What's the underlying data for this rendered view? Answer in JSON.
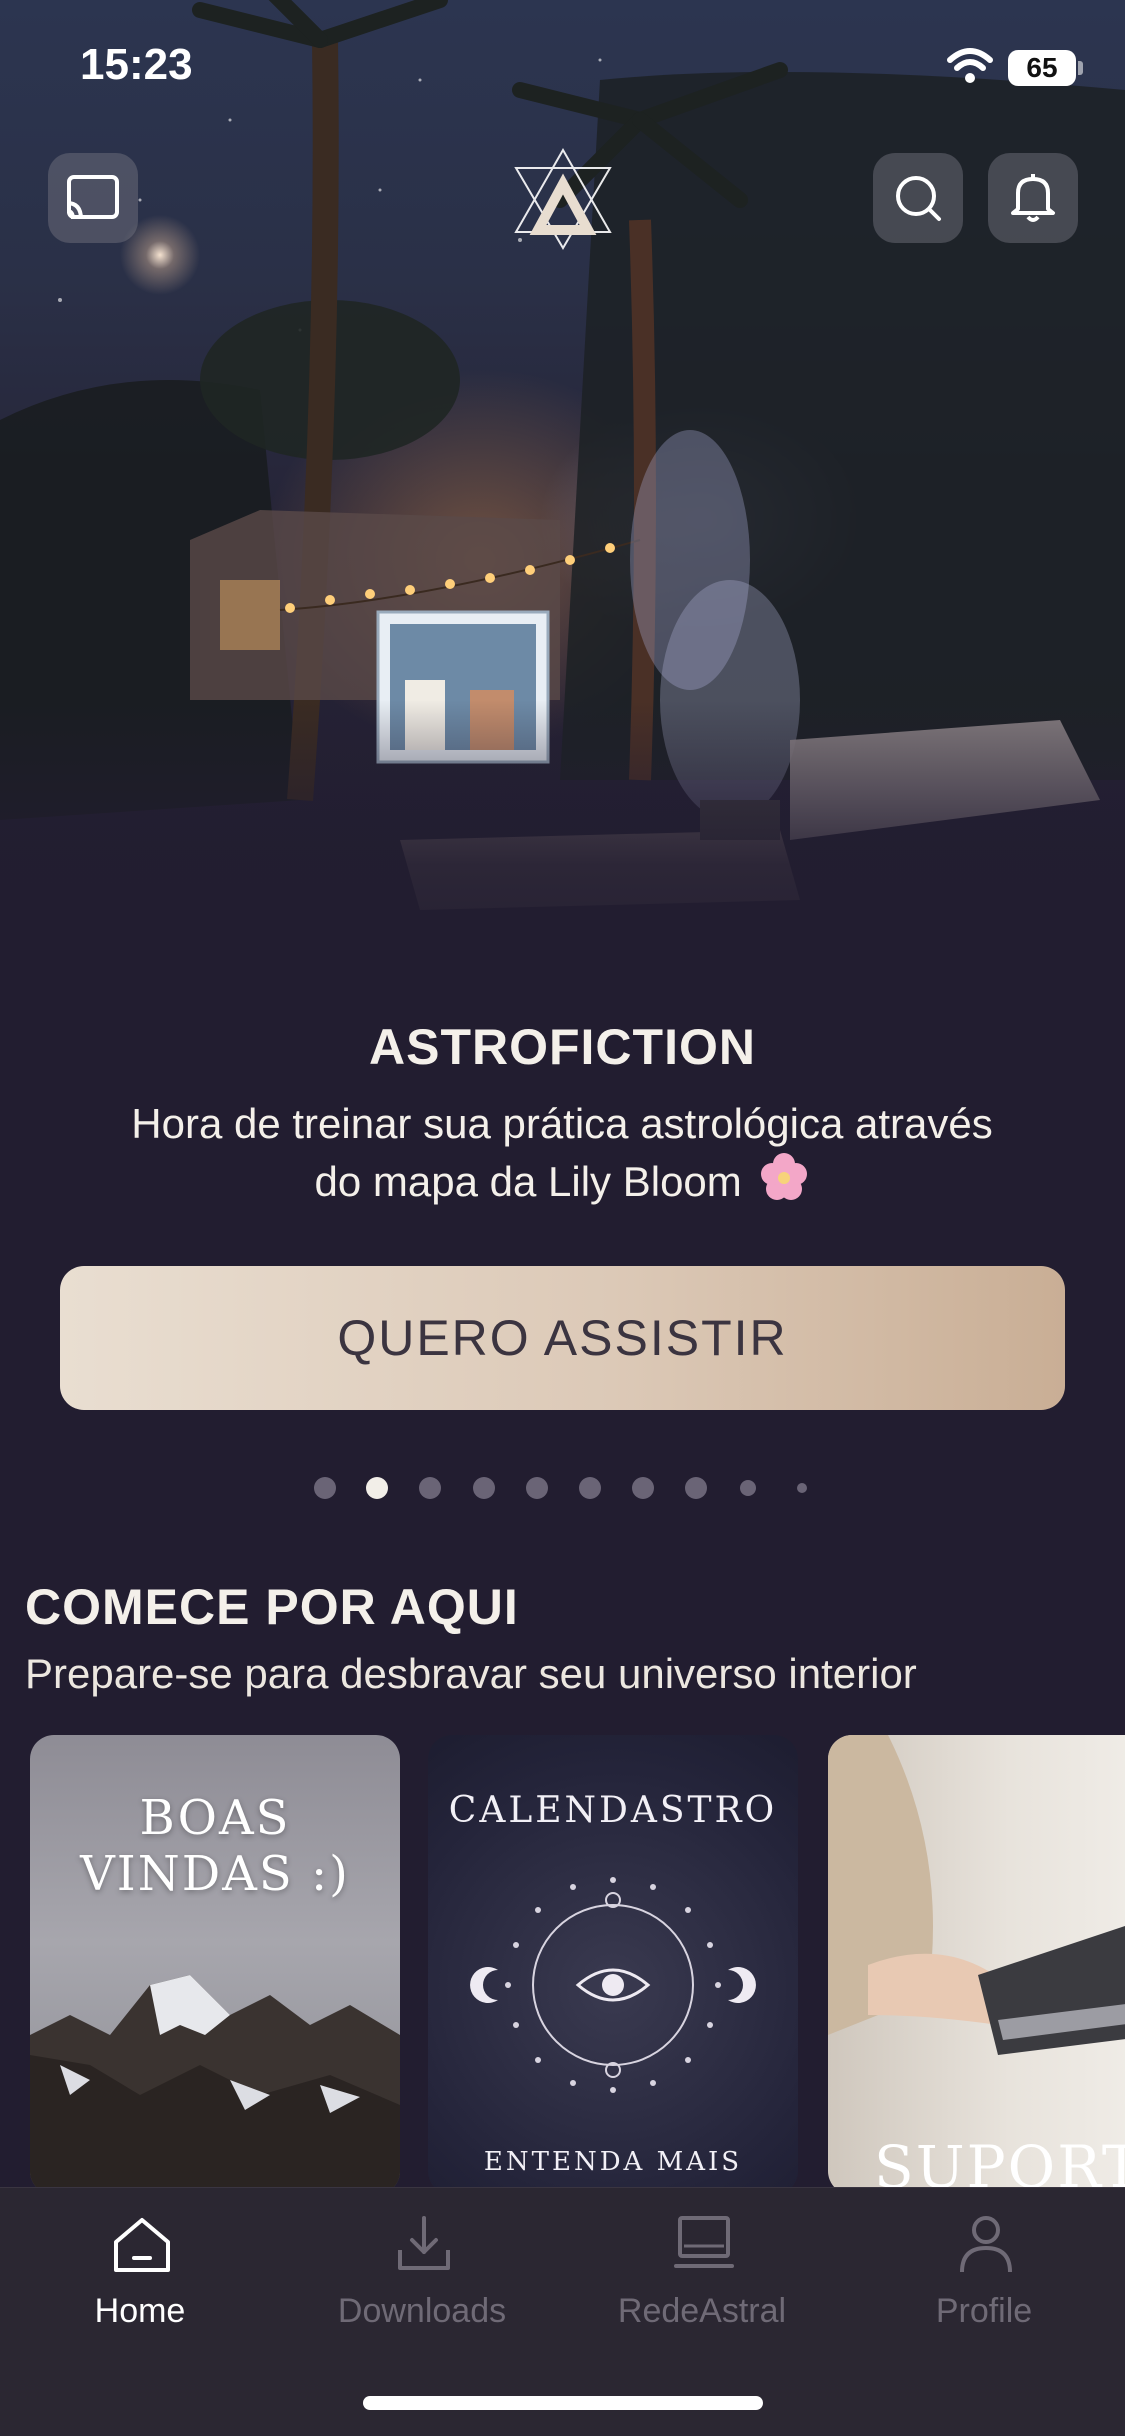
{
  "status_bar": {
    "time": "15:23",
    "battery": "65",
    "icons": [
      "wifi-icon",
      "battery-icon"
    ]
  },
  "header": {
    "left_icon": "cast-icon",
    "logo_icon": "astral-triangle-logo-icon",
    "right_icons": [
      "search-icon",
      "bell-icon"
    ]
  },
  "hero": {
    "title": "ASTROFICTION",
    "subtitle": "Hora de treinar sua prática astrológica através do mapa da Lily Bloom",
    "subtitle_emoji_icon": "cherry-blossom-icon",
    "cta_label": "QUERO ASSISTIR",
    "pagination": {
      "count": 10,
      "active_index": 1
    }
  },
  "section": {
    "title": "COMECE POR AQUI",
    "subtitle": "Prepare-se para desbravar seu universo interior",
    "cards": [
      {
        "title": "BOAS VINDAS :)"
      },
      {
        "title": "CALENDASTRO",
        "subtitle": "ENTENDA MAIS"
      },
      {
        "title": "SUPORTE"
      }
    ]
  },
  "tab_bar": {
    "tabs": [
      {
        "label": "Home",
        "icon": "home-icon",
        "active": true
      },
      {
        "label": "Downloads",
        "icon": "download-icon",
        "active": false
      },
      {
        "label": "RedeAstral",
        "icon": "laptop-icon",
        "active": false
      },
      {
        "label": "Profile",
        "icon": "person-icon",
        "active": false
      }
    ]
  },
  "colors": {
    "background": "#221d30",
    "cta_gradient_start": "#e9ded1",
    "cta_gradient_end": "#c9ae95",
    "active_tab": "#ffffff",
    "inactive_tab": "#6f6a76"
  }
}
